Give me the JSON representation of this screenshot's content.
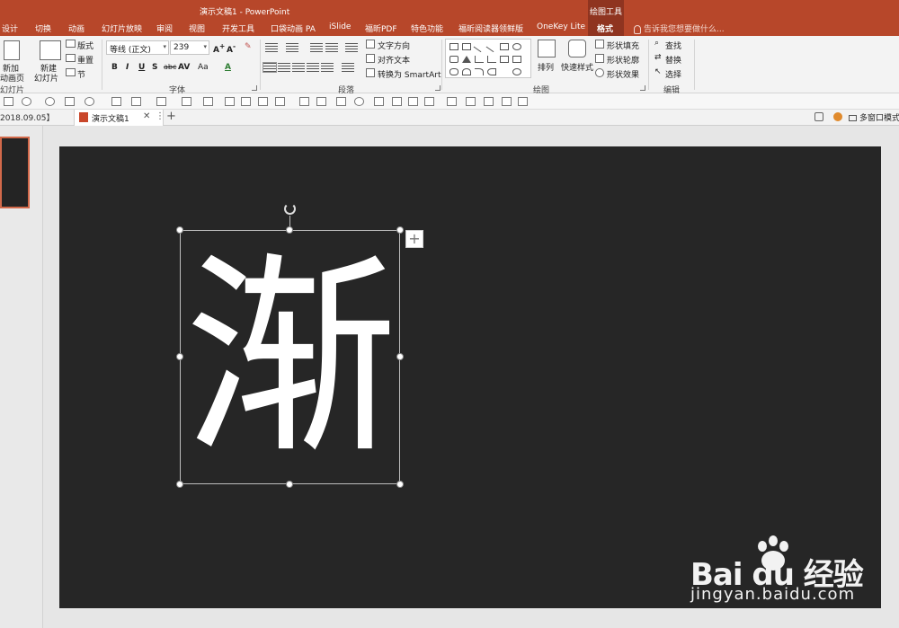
{
  "app": {
    "title": "演示文稿1 - PowerPoint",
    "context_group": "绘图工具",
    "tell_me": "告诉我您想要做什么..."
  },
  "tabs": [
    {
      "label": "设计"
    },
    {
      "label": "切换"
    },
    {
      "label": "动画"
    },
    {
      "label": "幻灯片放映"
    },
    {
      "label": "审阅"
    },
    {
      "label": "视图"
    },
    {
      "label": "开发工具"
    },
    {
      "label": "口袋动画 PA"
    },
    {
      "label": "iSlide"
    },
    {
      "label": "福昕PDF"
    },
    {
      "label": "特色功能"
    },
    {
      "label": "福昕阅读器领鲜版"
    },
    {
      "label": "OneKey Lite"
    },
    {
      "label": "格式"
    }
  ],
  "ribbon": {
    "slides_group": {
      "label": "幻灯片",
      "new_label_1": "新加",
      "new_label_2": "动画页",
      "new_slide_1": "新建",
      "new_slide_2": "幻灯片",
      "layout": "版式",
      "reset": "重置",
      "section": "节"
    },
    "font_group": {
      "label": "字体",
      "font_name": "等线 (正文)",
      "font_size": "239",
      "bold": "B",
      "italic": "I",
      "underline": "U",
      "shadow": "S",
      "strike": "abc",
      "spacing": "AV",
      "case": "Aa",
      "color": "A"
    },
    "paragraph_group": {
      "label": "段落",
      "text_direction": "文字方向",
      "align_text": "对齐文本",
      "smartart": "转换为 SmartArt"
    },
    "drawing_group": {
      "label": "绘图",
      "arrange": "排列",
      "quick_styles": "快速样式",
      "shape_fill": "形状填充",
      "shape_outline": "形状轮廓",
      "shape_effects": "形状效果"
    },
    "editing_group": {
      "label": "编辑",
      "find": "查找",
      "replace": "替换",
      "select": "选择"
    }
  },
  "doc_tabs": {
    "previous": "2018.09.05】",
    "current": "演示文稿1",
    "multi_window": "多窗口模式"
  },
  "slide": {
    "background": "#262626",
    "text": "渐"
  },
  "watermark": {
    "logo": "Bai du 经验",
    "url": "jingyan.baidu.com"
  },
  "colors": {
    "accent": "#b7472a",
    "context_tab": "#8f3420",
    "thumb_border": "#d2694a"
  }
}
